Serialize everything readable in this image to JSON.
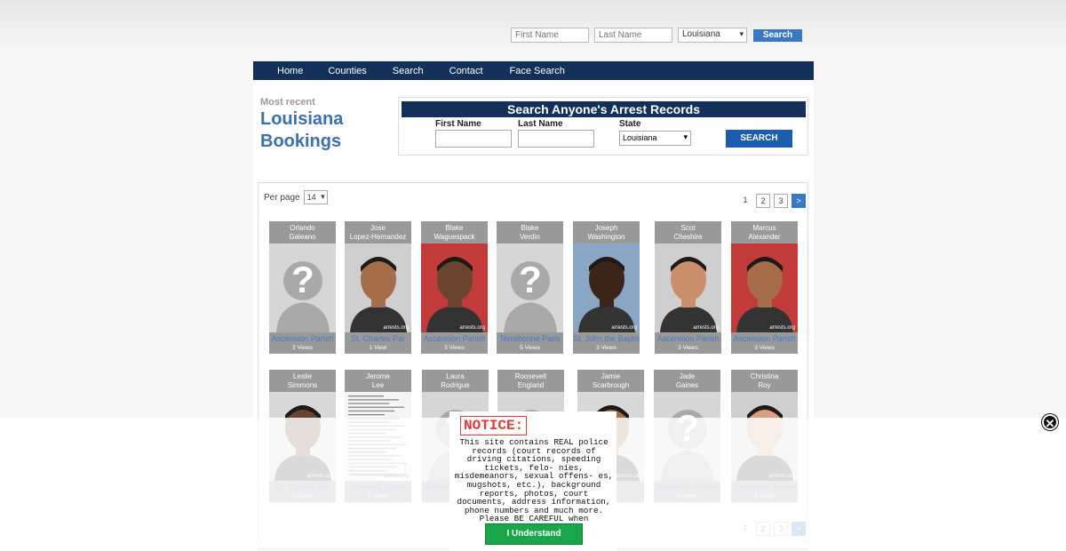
{
  "top_search": {
    "first_name_placeholder": "First Name",
    "last_name_placeholder": "Last Name",
    "state_value": "Louisiana",
    "search_label": "Search"
  },
  "nav": [
    "Home",
    "Counties",
    "Search",
    "Contact",
    "Face Search"
  ],
  "heading": {
    "small": "Most recent",
    "big_1": "Louisiana",
    "big_2": "Bookings"
  },
  "search_box": {
    "title": "Search Anyone's Arrest Records",
    "first_label": "First Name",
    "last_label": "Last Name",
    "state_label": "State",
    "state_value": "Louisiana",
    "button": "SEARCH"
  },
  "results": {
    "per_page_label": "Per page",
    "per_page_value": "14",
    "pages": [
      "1",
      "2",
      "3",
      ">"
    ],
    "watermark": "arrests.org",
    "cards": [
      {
        "first": "Orlando",
        "last": "Galeano",
        "parish": "Ascension Parish",
        "views": "2 Views",
        "photo": "placeholder"
      },
      {
        "first": "Jose",
        "last": "Lopez-Hernandez",
        "parish": "St. Charles Par",
        "views": "1 View",
        "photo": "mugshot"
      },
      {
        "first": "Blake",
        "last": "Waguespack",
        "parish": "Ascension Parish",
        "views": "3 Views",
        "photo": "mugshot"
      },
      {
        "first": "Blake",
        "last": "Verdin",
        "parish": "Terrebonne Paris",
        "views": "5 Views",
        "photo": "placeholder"
      },
      {
        "first": "Joseph",
        "last": "Washington",
        "parish": "St. John the Baptist",
        "views": "3 Views",
        "photo": "mugshot"
      },
      {
        "first": "Scot",
        "last": "Cheshire",
        "parish": "Ascension Parish",
        "views": "3 Views",
        "photo": "mugshot"
      },
      {
        "first": "Marcus",
        "last": "Alexander",
        "parish": "Ascension Parish",
        "views": "3 Views",
        "photo": "mugshot"
      },
      {
        "first": "Leslie",
        "last": "Simmons",
        "parish": "St. Charles Par",
        "views": "2 Views",
        "photo": "mugshot"
      },
      {
        "first": "Jerome",
        "last": "Lee",
        "parish": "Ouachita Parish",
        "views": "4 Views",
        "photo": "document"
      },
      {
        "first": "Laura",
        "last": "Rodrigue",
        "parish": "Terrebonne Paris",
        "views": "",
        "photo": "placeholder"
      },
      {
        "first": "Roosevelt",
        "last": "England",
        "parish": "",
        "views": "",
        "photo": "placeholder"
      },
      {
        "first": "Jamie",
        "last": "Scarbrough",
        "parish": "",
        "views": "",
        "photo": "mugshot"
      },
      {
        "first": "Jade",
        "last": "Gaines",
        "parish": "Ascension Parish",
        "views": "5 Views",
        "photo": "placeholder"
      },
      {
        "first": "Christina",
        "last": "Roy",
        "parish": "Ascension Parish",
        "views": "8 Views",
        "photo": "mugshot"
      }
    ]
  },
  "notice": {
    "title": "NOTICE:",
    "text": "This site contains REAL police records (court records of driving citations, speeding tickets, felo- nies, misdemeanors, sexual offens- es, mugshots, etc.), background reports, photos, court documents, address information, phone numbers and much more. Please BE CAREFUL when conducting a search",
    "button": "I Understand"
  },
  "colors": {
    "nav_bg": "#12305a",
    "accent": "#3a78c3",
    "link": "#4a78c8",
    "ok_green": "#1aa64a",
    "notice_red": "#e53935"
  }
}
